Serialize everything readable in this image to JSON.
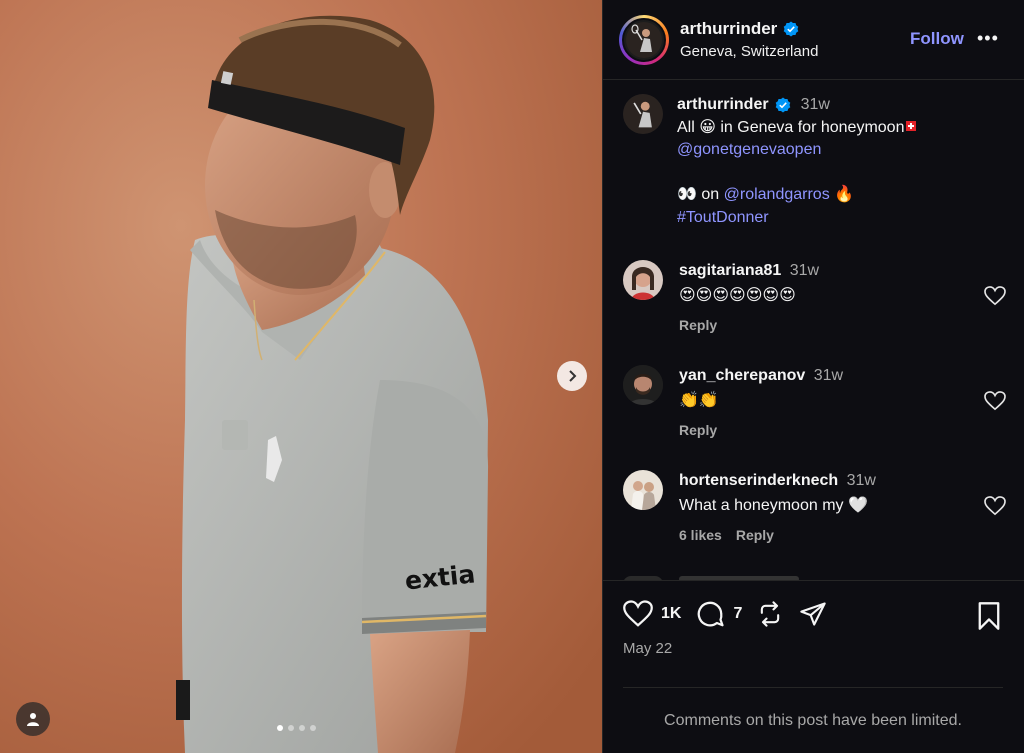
{
  "header": {
    "username": "arthurrinder",
    "location": "Geneva, Switzerland",
    "follow_label": "Follow",
    "more_label": "•••"
  },
  "caption": {
    "username": "arthurrinder",
    "time": "31w",
    "line1": "All 😀 in Geneva for honeymoon",
    "mention1": "@gonetgenevaopen",
    "line3_prefix": "👀 on",
    "mention2": "@rolandgarros",
    "line3_suffix": "🔥",
    "hashtag": "#ToutDonner"
  },
  "comments": [
    {
      "username": "sagitariana81",
      "time": "31w",
      "text": "😍😍😍😍😍😍😍",
      "likes": "",
      "reply": "Reply"
    },
    {
      "username": "yan_cherepanov",
      "time": "31w",
      "text": "👏👏",
      "likes": "",
      "reply": "Reply"
    },
    {
      "username": "hortenserinderknech",
      "time": "31w",
      "text": "What a honeymoon my 🤍",
      "likes": "6 likes",
      "reply": "Reply"
    }
  ],
  "actions": {
    "like_count": "1K",
    "comment_count": "7",
    "date": "May 22",
    "limited_notice": "Comments on this post have been limited."
  },
  "media": {
    "sponsor_text": "extia",
    "carousel_total": 4,
    "carousel_active": 1
  },
  "colors": {
    "link": "#8f95ff",
    "verified": "#0095f6",
    "background": "#0d0d12"
  }
}
